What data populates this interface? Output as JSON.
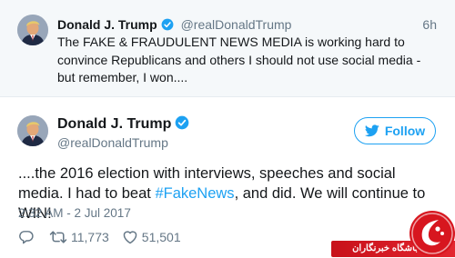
{
  "parent_tweet": {
    "name": "Donald J. Trump",
    "handle": "@realDonaldTrump",
    "time": "6h",
    "text": "The FAKE & FRAUDULENT NEWS MEDIA is working hard to convince Republicans and others I should not use social media - but remember, I won...."
  },
  "main_tweet": {
    "name": "Donald J. Trump",
    "handle": "@realDonaldTrump",
    "follow_label": "Follow",
    "text_before": "....the 2016 election with interviews, speeches and social media. I had to beat ",
    "hashtag": "#FakeNews",
    "text_after": ", and did. We will continue to WIN!",
    "timestamp": "2:32 AM - 2 Jul 2017",
    "retweet_count": "11,773",
    "like_count": "51,501"
  },
  "watermark": {
    "text": "باشگاه خبرنگاران"
  },
  "colors": {
    "accent": "#1da1f2",
    "secondary_text": "#657786",
    "parent_background": "#f5f8fa",
    "watermark_red": "#d7161f"
  },
  "icons": {
    "verified": "verified-badge-icon",
    "follow": "twitter-bird-icon",
    "reply": "reply-icon",
    "retweet": "retweet-icon",
    "like": "heart-icon",
    "watermark": "yjc-logo"
  }
}
